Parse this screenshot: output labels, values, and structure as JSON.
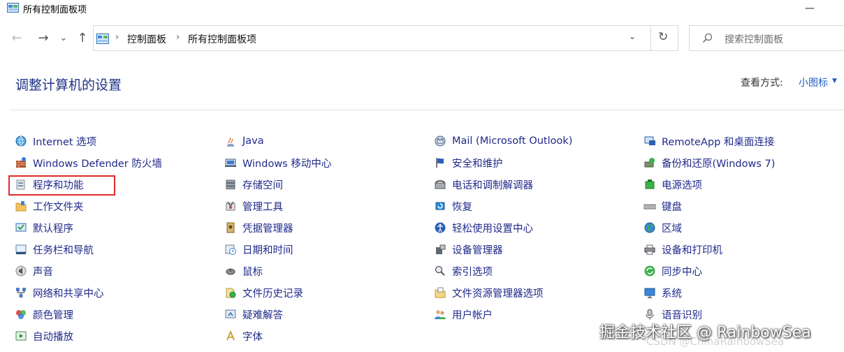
{
  "window": {
    "title": "所有控制面板项",
    "minimize_glyph": "—"
  },
  "nav": {
    "back_glyph": "←",
    "forward_glyph": "→",
    "recent_glyph": "⌄",
    "up_glyph": "↑"
  },
  "address": {
    "crumbs": [
      "控制面板",
      "所有控制面板项"
    ],
    "separator": "›",
    "dropdown_glyph": "⌄",
    "refresh_glyph": "↻"
  },
  "search": {
    "placeholder": "搜索控制面板"
  },
  "header": {
    "title": "调整计算机的设置",
    "view_by_label": "查看方式:",
    "view_by_value": "小图标",
    "view_by_arrow": "▼"
  },
  "columns": [
    [
      {
        "label": "Internet 选项",
        "icon": "globe-icon"
      },
      {
        "label": "Windows Defender 防火墙",
        "icon": "firewall-icon"
      },
      {
        "label": "程序和功能",
        "icon": "programs-icon"
      },
      {
        "label": "工作文件夹",
        "icon": "folder-icon"
      },
      {
        "label": "默认程序",
        "icon": "default-programs-icon"
      },
      {
        "label": "任务栏和导航",
        "icon": "taskbar-icon"
      },
      {
        "label": "声音",
        "icon": "speaker-icon"
      },
      {
        "label": "网络和共享中心",
        "icon": "network-icon"
      },
      {
        "label": "颜色管理",
        "icon": "color-icon"
      },
      {
        "label": "自动播放",
        "icon": "autoplay-icon"
      }
    ],
    [
      {
        "label": "Java",
        "icon": "java-icon"
      },
      {
        "label": "Windows 移动中心",
        "icon": "mobility-icon"
      },
      {
        "label": "存储空间",
        "icon": "storage-icon"
      },
      {
        "label": "管理工具",
        "icon": "tools-icon"
      },
      {
        "label": "凭据管理器",
        "icon": "credential-icon"
      },
      {
        "label": "日期和时间",
        "icon": "clock-icon"
      },
      {
        "label": "鼠标",
        "icon": "mouse-icon"
      },
      {
        "label": "文件历史记录",
        "icon": "history-icon"
      },
      {
        "label": "疑难解答",
        "icon": "troubleshoot-icon"
      },
      {
        "label": "字体",
        "icon": "font-icon"
      }
    ],
    [
      {
        "label": "Mail (Microsoft Outlook)",
        "icon": "mail-icon"
      },
      {
        "label": "安全和维护",
        "icon": "flag-icon"
      },
      {
        "label": "电话和调制解调器",
        "icon": "phone-icon"
      },
      {
        "label": "恢复",
        "icon": "recovery-icon"
      },
      {
        "label": "轻松使用设置中心",
        "icon": "accessibility-icon"
      },
      {
        "label": "设备管理器",
        "icon": "device-manager-icon"
      },
      {
        "label": "索引选项",
        "icon": "index-icon"
      },
      {
        "label": "文件资源管理器选项",
        "icon": "explorer-options-icon"
      },
      {
        "label": "用户帐户",
        "icon": "users-icon"
      }
    ],
    [
      {
        "label": "RemoteApp 和桌面连接",
        "icon": "remote-icon"
      },
      {
        "label": "备份和还原(Windows 7)",
        "icon": "backup-icon"
      },
      {
        "label": "电源选项",
        "icon": "power-icon"
      },
      {
        "label": "键盘",
        "icon": "keyboard-icon"
      },
      {
        "label": "区域",
        "icon": "region-icon"
      },
      {
        "label": "设备和打印机",
        "icon": "printer-icon"
      },
      {
        "label": "同步中心",
        "icon": "sync-icon"
      },
      {
        "label": "系统",
        "icon": "system-icon"
      },
      {
        "label": "语音识别",
        "icon": "microphone-icon"
      }
    ]
  ],
  "watermark": {
    "text": "掘金技术社区 @ RainbowSea",
    "sub": "CSDN @ChinaRainbowSea"
  },
  "colors": {
    "title": "#1e3287",
    "link": "#1f2a8a",
    "accent": "#1f5fbf",
    "highlight_border": "#e02b2b"
  }
}
